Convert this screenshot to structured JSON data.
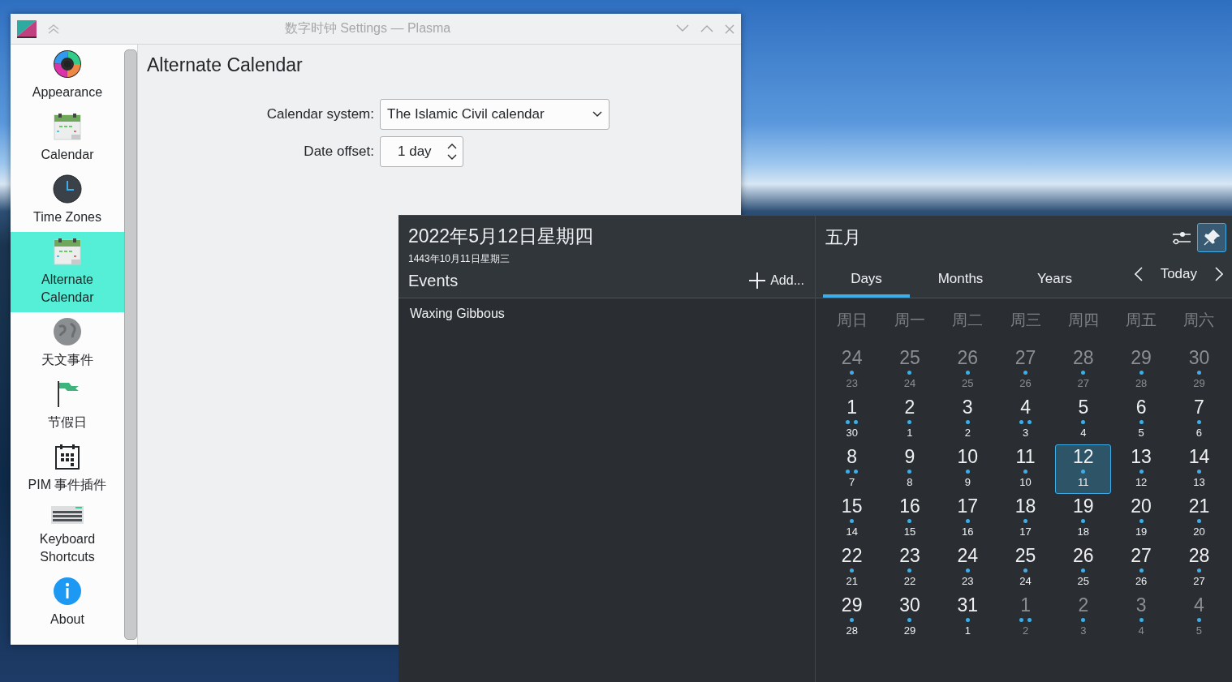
{
  "settings_window": {
    "title": "数字时钟 Settings — Plasma",
    "sidebar": [
      {
        "label": "Appearance",
        "kind": "palette",
        "selected": false
      },
      {
        "label": "Calendar",
        "kind": "calendar",
        "selected": false
      },
      {
        "label": "Time Zones",
        "kind": "clock",
        "selected": false
      },
      {
        "label": "Alternate Calendar",
        "kind": "calendar",
        "selected": true
      },
      {
        "label": "天文事件",
        "kind": "moon",
        "selected": false
      },
      {
        "label": "节假日",
        "kind": "flag",
        "selected": false
      },
      {
        "label": "PIM 事件插件",
        "kind": "grid",
        "selected": false
      },
      {
        "label": "Keyboard Shortcuts",
        "kind": "keyboard",
        "selected": false
      },
      {
        "label": "About",
        "kind": "info",
        "selected": false
      }
    ],
    "page_title": "Alternate Calendar",
    "fields": [
      {
        "kind": "dropdown",
        "label": "Calendar system:",
        "value": "The Islamic Civil calendar"
      },
      {
        "kind": "spinbox",
        "label": "Date offset:",
        "value": "1 day"
      }
    ]
  },
  "calendar_popup": {
    "date": "2022年5月12日星期四",
    "alt_date": "1443年10月11日星期三",
    "events_heading": "Events",
    "add_button": "Add...",
    "events": [
      "Waxing Gibbous"
    ],
    "month": "五月",
    "pinned": true,
    "tabs": [
      {
        "label": "Days",
        "selected": true
      },
      {
        "label": "Months",
        "selected": false
      },
      {
        "label": "Years",
        "selected": false
      }
    ],
    "today_button": "Today",
    "weekdays": [
      "周日",
      "周一",
      "周二",
      "周三",
      "周四",
      "周五",
      "周六"
    ],
    "days": [
      {
        "day": "24",
        "alt": "23",
        "kind": "single",
        "in_month": false,
        "selected": false
      },
      {
        "day": "25",
        "alt": "24",
        "kind": "single",
        "in_month": false,
        "selected": false
      },
      {
        "day": "26",
        "alt": "25",
        "kind": "single",
        "in_month": false,
        "selected": false
      },
      {
        "day": "27",
        "alt": "26",
        "kind": "single",
        "in_month": false,
        "selected": false
      },
      {
        "day": "28",
        "alt": "27",
        "kind": "single",
        "in_month": false,
        "selected": false
      },
      {
        "day": "29",
        "alt": "28",
        "kind": "single",
        "in_month": false,
        "selected": false
      },
      {
        "day": "30",
        "alt": "29",
        "kind": "single",
        "in_month": false,
        "selected": false
      },
      {
        "day": "1",
        "alt": "30",
        "kind": "double",
        "in_month": true,
        "selected": false
      },
      {
        "day": "2",
        "alt": "1",
        "kind": "single",
        "in_month": true,
        "selected": false
      },
      {
        "day": "3",
        "alt": "2",
        "kind": "single",
        "in_month": true,
        "selected": false
      },
      {
        "day": "4",
        "alt": "3",
        "kind": "double",
        "in_month": true,
        "selected": false
      },
      {
        "day": "5",
        "alt": "4",
        "kind": "single",
        "in_month": true,
        "selected": false
      },
      {
        "day": "6",
        "alt": "5",
        "kind": "single",
        "in_month": true,
        "selected": false
      },
      {
        "day": "7",
        "alt": "6",
        "kind": "single",
        "in_month": true,
        "selected": false
      },
      {
        "day": "8",
        "alt": "7",
        "kind": "double",
        "in_month": true,
        "selected": false
      },
      {
        "day": "9",
        "alt": "8",
        "kind": "single",
        "in_month": true,
        "selected": false
      },
      {
        "day": "10",
        "alt": "9",
        "kind": "single",
        "in_month": true,
        "selected": false
      },
      {
        "day": "11",
        "alt": "10",
        "kind": "single",
        "in_month": true,
        "selected": false
      },
      {
        "day": "12",
        "alt": "11",
        "kind": "single",
        "in_month": true,
        "selected": true
      },
      {
        "day": "13",
        "alt": "12",
        "kind": "single",
        "in_month": true,
        "selected": false
      },
      {
        "day": "14",
        "alt": "13",
        "kind": "single",
        "in_month": true,
        "selected": false
      },
      {
        "day": "15",
        "alt": "14",
        "kind": "single",
        "in_month": true,
        "selected": false
      },
      {
        "day": "16",
        "alt": "15",
        "kind": "single",
        "in_month": true,
        "selected": false
      },
      {
        "day": "17",
        "alt": "16",
        "kind": "single",
        "in_month": true,
        "selected": false
      },
      {
        "day": "18",
        "alt": "17",
        "kind": "single",
        "in_month": true,
        "selected": false
      },
      {
        "day": "19",
        "alt": "18",
        "kind": "single",
        "in_month": true,
        "selected": false
      },
      {
        "day": "20",
        "alt": "19",
        "kind": "single",
        "in_month": true,
        "selected": false
      },
      {
        "day": "21",
        "alt": "20",
        "kind": "single",
        "in_month": true,
        "selected": false
      },
      {
        "day": "22",
        "alt": "21",
        "kind": "single",
        "in_month": true,
        "selected": false
      },
      {
        "day": "23",
        "alt": "22",
        "kind": "single",
        "in_month": true,
        "selected": false
      },
      {
        "day": "24",
        "alt": "23",
        "kind": "single",
        "in_month": true,
        "selected": false
      },
      {
        "day": "25",
        "alt": "24",
        "kind": "single",
        "in_month": true,
        "selected": false
      },
      {
        "day": "26",
        "alt": "25",
        "kind": "single",
        "in_month": true,
        "selected": false
      },
      {
        "day": "27",
        "alt": "26",
        "kind": "single",
        "in_month": true,
        "selected": false
      },
      {
        "day": "28",
        "alt": "27",
        "kind": "single",
        "in_month": true,
        "selected": false
      },
      {
        "day": "29",
        "alt": "28",
        "kind": "single",
        "in_month": true,
        "selected": false
      },
      {
        "day": "30",
        "alt": "29",
        "kind": "single",
        "in_month": true,
        "selected": false
      },
      {
        "day": "31",
        "alt": "1",
        "kind": "single",
        "in_month": true,
        "selected": false
      },
      {
        "day": "1",
        "alt": "2",
        "kind": "double",
        "in_month": false,
        "selected": false
      },
      {
        "day": "2",
        "alt": "3",
        "kind": "single",
        "in_month": false,
        "selected": false
      },
      {
        "day": "3",
        "alt": "4",
        "kind": "single",
        "in_month": false,
        "selected": false
      },
      {
        "day": "4",
        "alt": "5",
        "kind": "single",
        "in_month": false,
        "selected": false
      }
    ]
  }
}
